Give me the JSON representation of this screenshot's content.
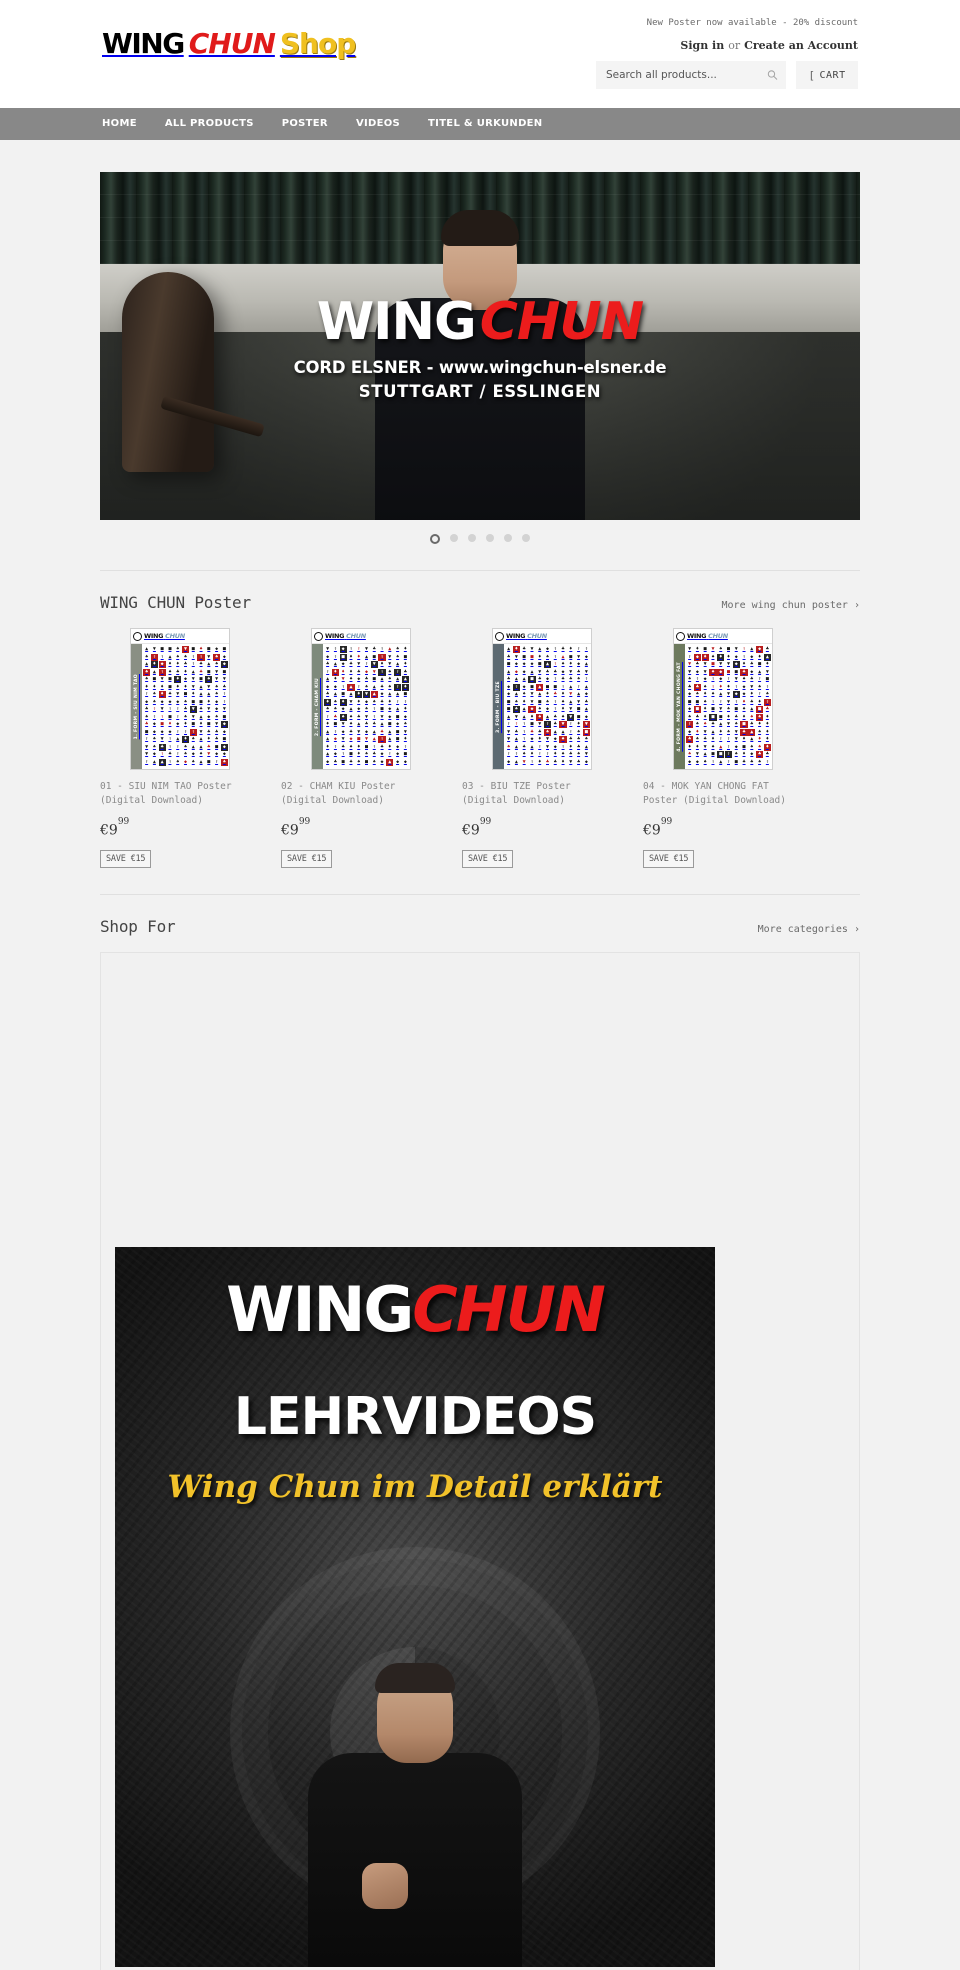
{
  "header": {
    "logo": {
      "wing": "WING",
      "chun": "CHUN",
      "shop": "Shop"
    },
    "promo": "New Poster now available - 20% discount",
    "sign_in": "Sign in",
    "or": "or",
    "create_account": "Create an Account",
    "search_placeholder": "Search all products...",
    "search_value": "",
    "search_icon": "search-icon",
    "cart_label": "CART",
    "cart_icon": "cart-icon"
  },
  "nav": {
    "items": [
      {
        "label": "HOME"
      },
      {
        "label": "ALL PRODUCTS"
      },
      {
        "label": "POSTER"
      },
      {
        "label": "VIDEOS"
      },
      {
        "label": "TITEL & URKUNDEN"
      }
    ]
  },
  "hero": {
    "title_white": "WING",
    "title_red": "CHUN",
    "subtitle1": "CORD ELSNER - www.wingchun-elsner.de",
    "subtitle2": "STUTTGART / ESSLINGEN",
    "slides": 6,
    "active_slide": 1
  },
  "poster_section": {
    "title": "WING CHUN Poster",
    "more_label": "More wing chun poster  ›",
    "products": [
      {
        "title": "01 - SIU NIM TAO Poster (Digital Download)",
        "price_main": "€9",
        "price_cents": "99",
        "save_badge": "SAVE €15",
        "poster_head_wing": "WING",
        "poster_head_chun": "CHUN",
        "poster_spine": "1. FORM - SIU NIM TAO",
        "spine_color": "#8a8f84",
        "index": "1"
      },
      {
        "title": "02 - CHAM KIU Poster (Digital Download)",
        "price_main": "€9",
        "price_cents": "99",
        "save_badge": "SAVE €15",
        "poster_head_wing": "WING",
        "poster_head_chun": "CHUN",
        "poster_spine": "2. FORM - CHAM KIU",
        "spine_color": "#7e8a7c",
        "index": "2"
      },
      {
        "title": "03 - BIU TZE Poster (Digital Download)",
        "price_main": "€9",
        "price_cents": "99",
        "save_badge": "SAVE €15",
        "poster_head_wing": "WING",
        "poster_head_chun": "CHUN",
        "poster_spine": "3. FORM - BIU TZE",
        "spine_color": "#5d6a72",
        "index": "3"
      },
      {
        "title": "04 - MOK YAN CHONG FAT Poster (Digital Download)",
        "price_main": "€9",
        "price_cents": "99",
        "save_badge": "SAVE €15",
        "poster_head_wing": "WING",
        "poster_head_chun": "CHUN",
        "poster_spine": "4. FORM - MOK YAN CHONG FAT",
        "spine_color": "#6d7a5e",
        "index": "4"
      }
    ]
  },
  "shop_for": {
    "title": "Shop For",
    "more_label": "More categories  ›"
  },
  "video_banner": {
    "title_white": "WING",
    "title_red": "CHUN",
    "subtitle": "LEHRVIDEOS",
    "tagline": "Wing Chun im Detail erklärt"
  },
  "colors": {
    "brand_red": "#ec1c1c",
    "brand_yellow": "#f0c020",
    "nav_bg": "#888888",
    "page_bg": "#f2f2f2"
  }
}
